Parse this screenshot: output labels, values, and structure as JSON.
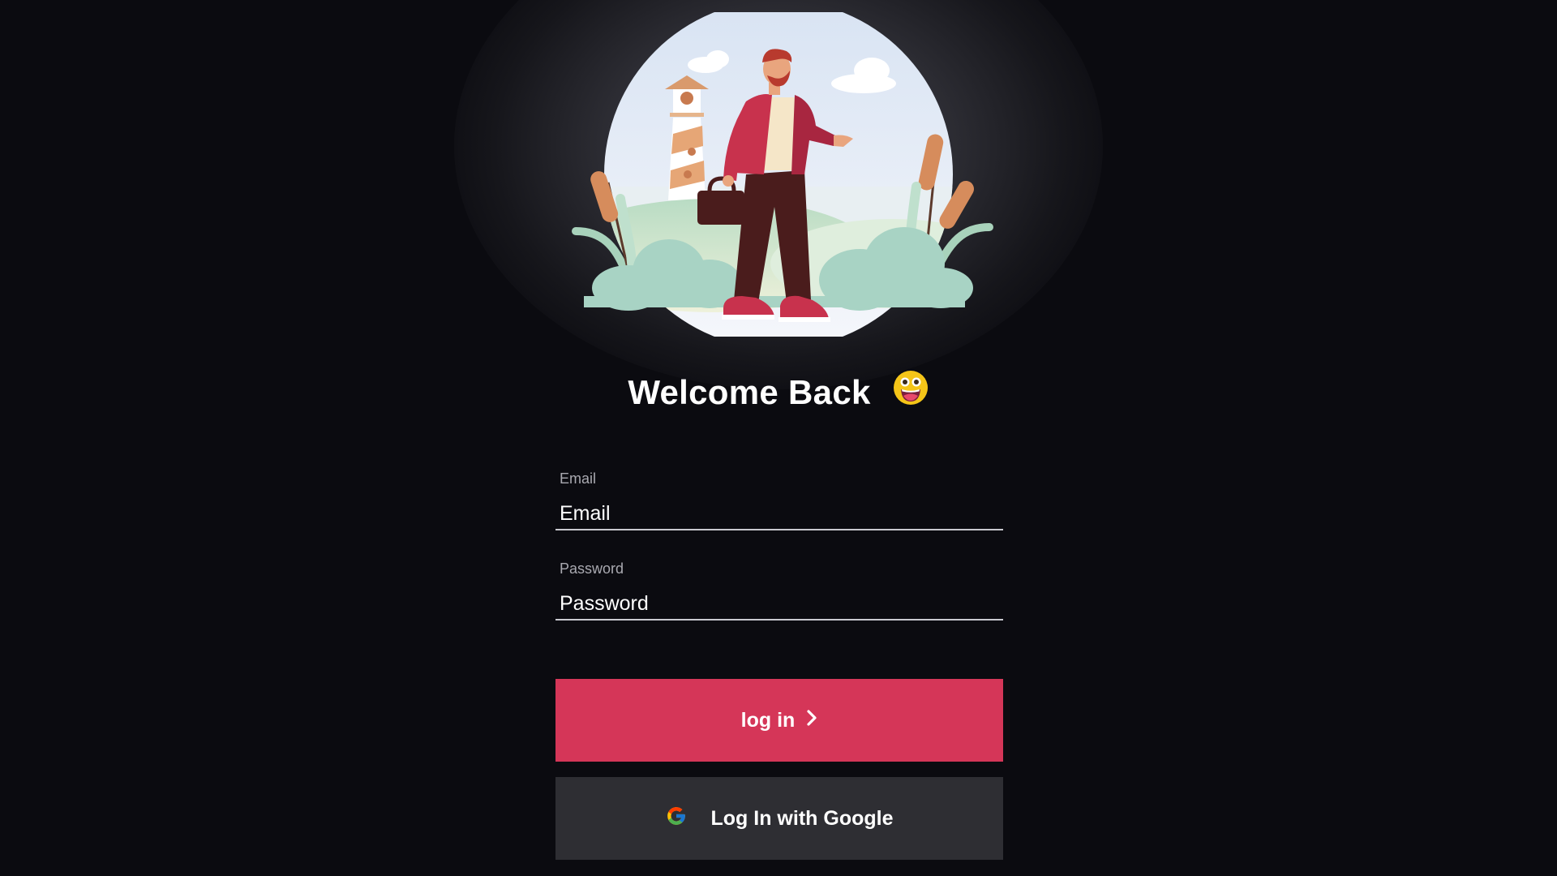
{
  "welcome": {
    "title": "Welcome Back"
  },
  "form": {
    "email": {
      "label": "Email",
      "placeholder": "Email",
      "value": ""
    },
    "password": {
      "label": "Password",
      "placeholder": "Password",
      "value": ""
    }
  },
  "buttons": {
    "login_label": "log in",
    "google_label": "Log In with Google"
  },
  "icons": {
    "emoji": "grinning-face-emoji",
    "login_arrow": "chevron-right-icon",
    "google": "google-icon"
  },
  "colors": {
    "background": "#0b0b10",
    "primary_button": "#d53658",
    "secondary_button": "#2e2e33",
    "field_underline": "#c9c9cf",
    "label": "#a9a9b0"
  }
}
